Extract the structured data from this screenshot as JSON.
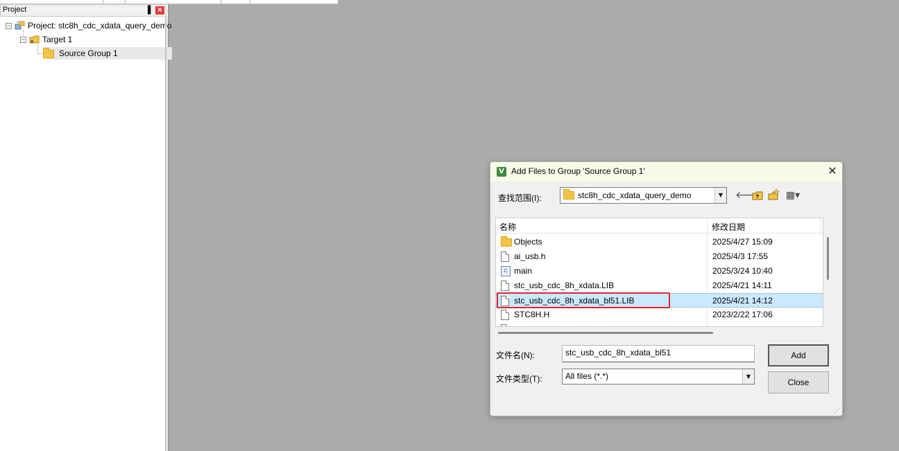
{
  "project_panel": {
    "title": "Project",
    "pin_glyph": "▐",
    "close_glyph": "×",
    "tree": {
      "project": "Project: stc8h_cdc_xdata_query_demo",
      "target": "Target 1",
      "group": "Source Group 1"
    }
  },
  "dialog": {
    "title": "Add Files to Group 'Source Group 1'",
    "app_icon_glyph": "V",
    "close_glyph": "✕",
    "look_in_label": "查找范围(I):",
    "look_in_value": "stc8h_cdc_xdata_query_demo",
    "toolbar": {
      "back_glyph": "🡐",
      "up_glyph": "⬑",
      "new_folder_glyph": "✦",
      "view_menu_glyph": "▦▾"
    },
    "columns": {
      "name": "名称",
      "date": "修改日期"
    },
    "files": [
      {
        "name": "Objects",
        "date": "2025/4/27 15:09",
        "icon": "folder-icon"
      },
      {
        "name": "ai_usb.h",
        "date": "2025/4/3 17:55",
        "icon": "file-icon"
      },
      {
        "name": "main",
        "date": "2025/3/24 10:40",
        "icon": "c-source-icon"
      },
      {
        "name": "stc_usb_cdc_8h_xdata.LIB",
        "date": "2025/4/21 14:11",
        "icon": "file-icon"
      },
      {
        "name": "stc_usb_cdc_8h_xdata_bl51.LIB",
        "date": "2025/4/21 14:12",
        "icon": "file-icon",
        "selected": true
      },
      {
        "name": "STC8H.H",
        "date": "2023/2/22 17:06",
        "icon": "file-icon"
      }
    ],
    "file_name_label": "文件名(N):",
    "file_name_value": "stc_usb_cdc_8h_xdata_bl51",
    "file_type_label": "文件类型(T):",
    "file_type_value": "All files (*.*)",
    "add_label": "Add",
    "close_label": "Close"
  }
}
